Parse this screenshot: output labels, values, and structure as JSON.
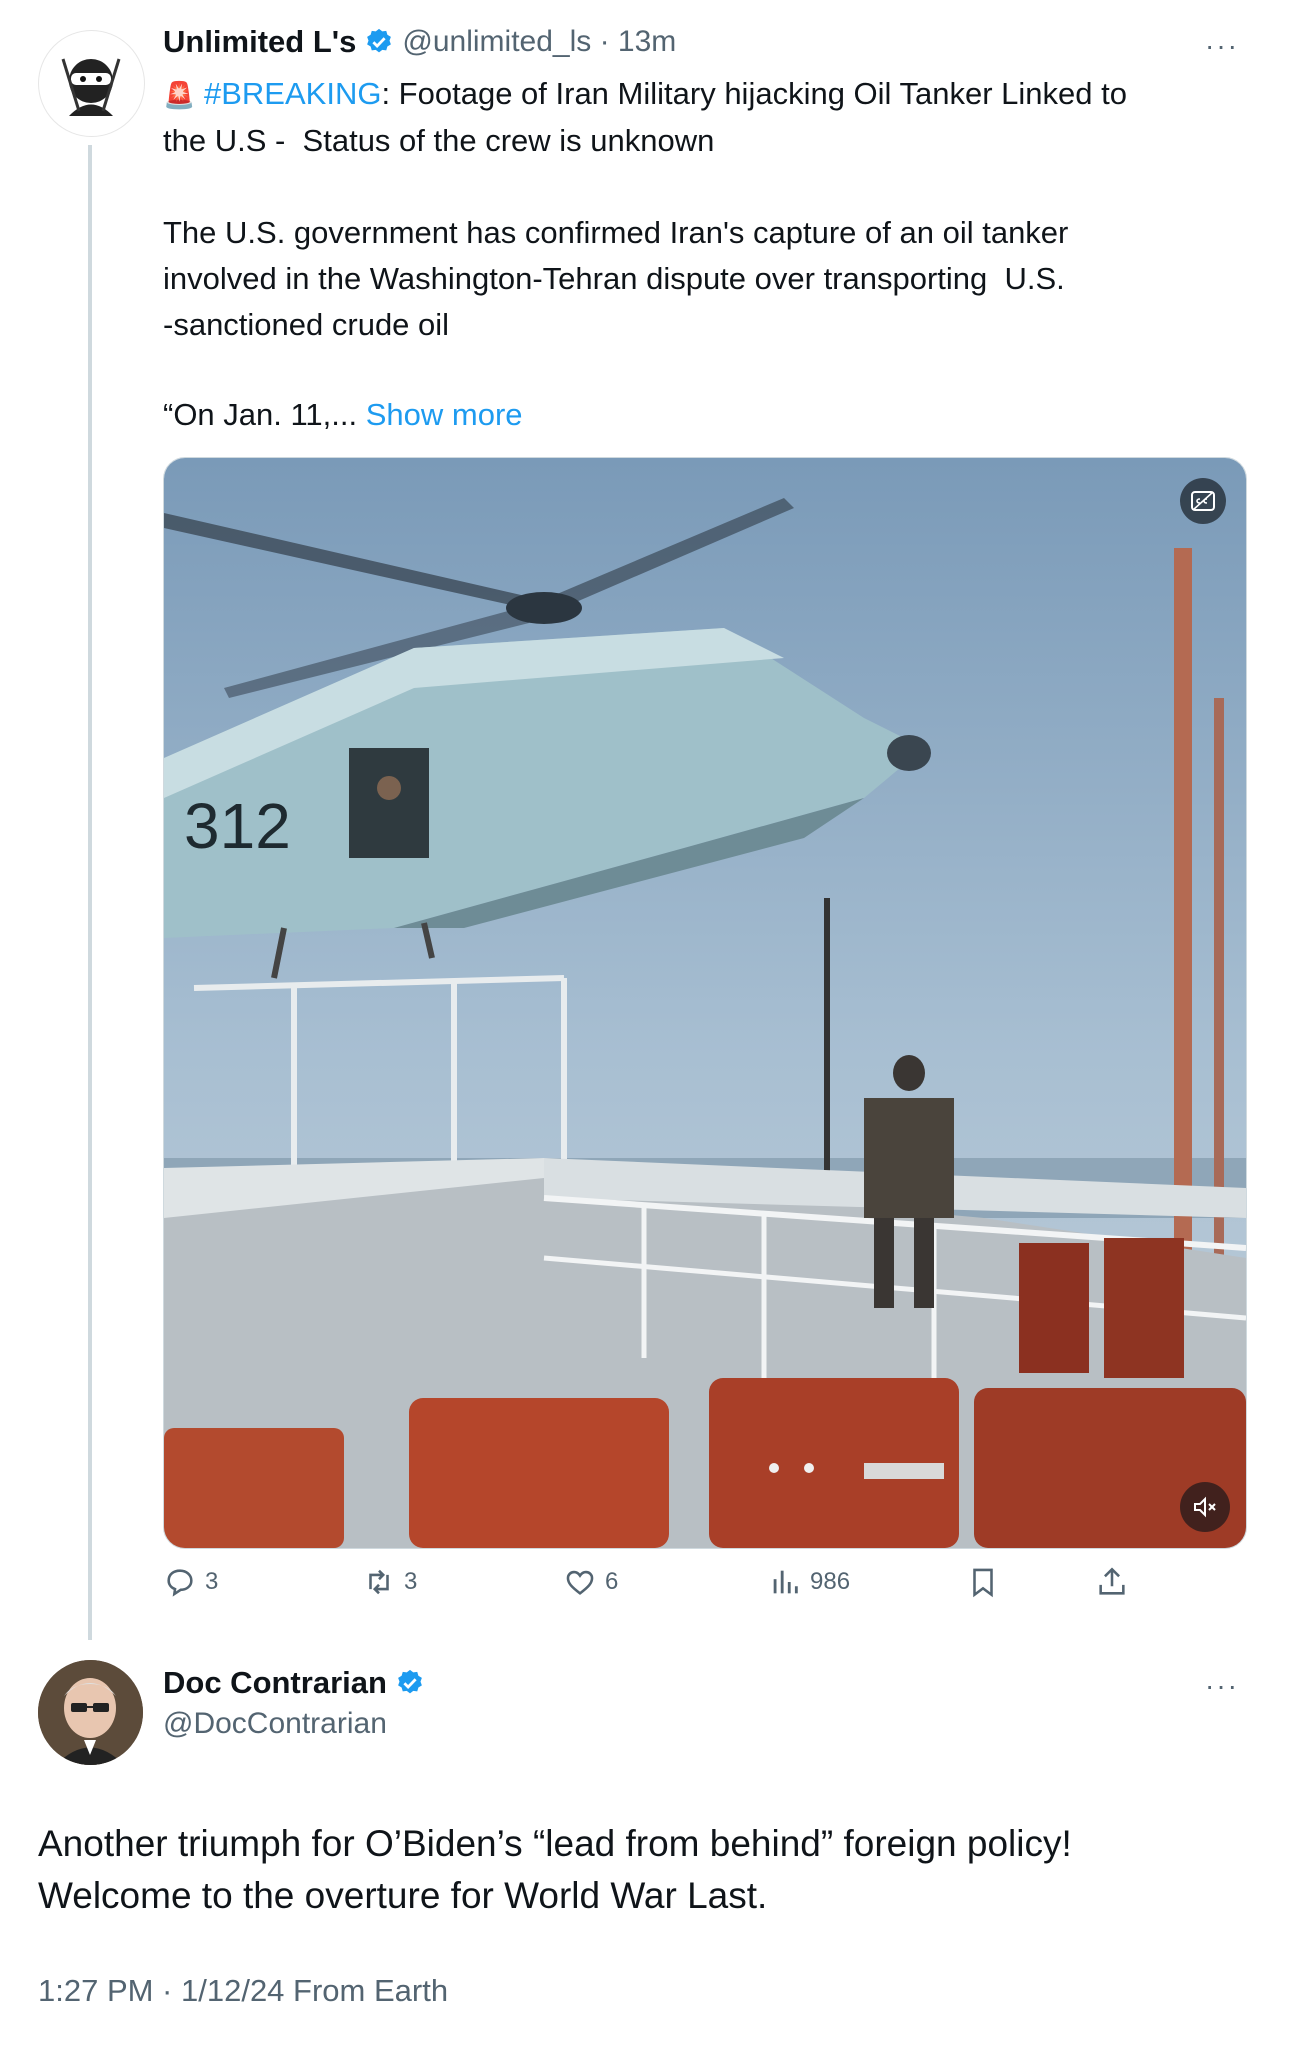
{
  "tweet1": {
    "display_name": "Unlimited L's",
    "handle_time": "@unlimited_ls · 13m",
    "more": "···",
    "breaking_emoji": "🚨",
    "hashtag": "#BREAKING",
    "line1_rest": ": Footage of Iran Military hijacking Oil Tanker Linked to",
    "line2": "the U.S -  Status of the crew is unknown",
    "para2": "The U.S. government has confirmed Iran's capture of an oil tanker\ninvolved in the Washington-Tehran dispute over transporting  U.S.\n-sanctioned crude oil",
    "para3_start": "“On Jan. 11,... ",
    "show_more": "Show more",
    "media": {
      "helicopter_number": "312",
      "cc_icon": "captions-icon",
      "mute_icon": "muted-speaker-icon"
    },
    "actions": {
      "replies": "3",
      "reposts": "3",
      "likes": "6",
      "views": "986"
    }
  },
  "tweet2": {
    "display_name": "Doc Contrarian",
    "handle": "@DocContrarian",
    "more": "···",
    "text": "Another triumph for O’Biden’s “lead from behind” foreign policy!\nWelcome to the overture for World War Last.",
    "meta": "1:27 PM · 1/12/24 From Earth"
  },
  "colors": {
    "accent": "#1d9bf0",
    "muted": "#536471",
    "thread_line": "#cfd9de"
  }
}
